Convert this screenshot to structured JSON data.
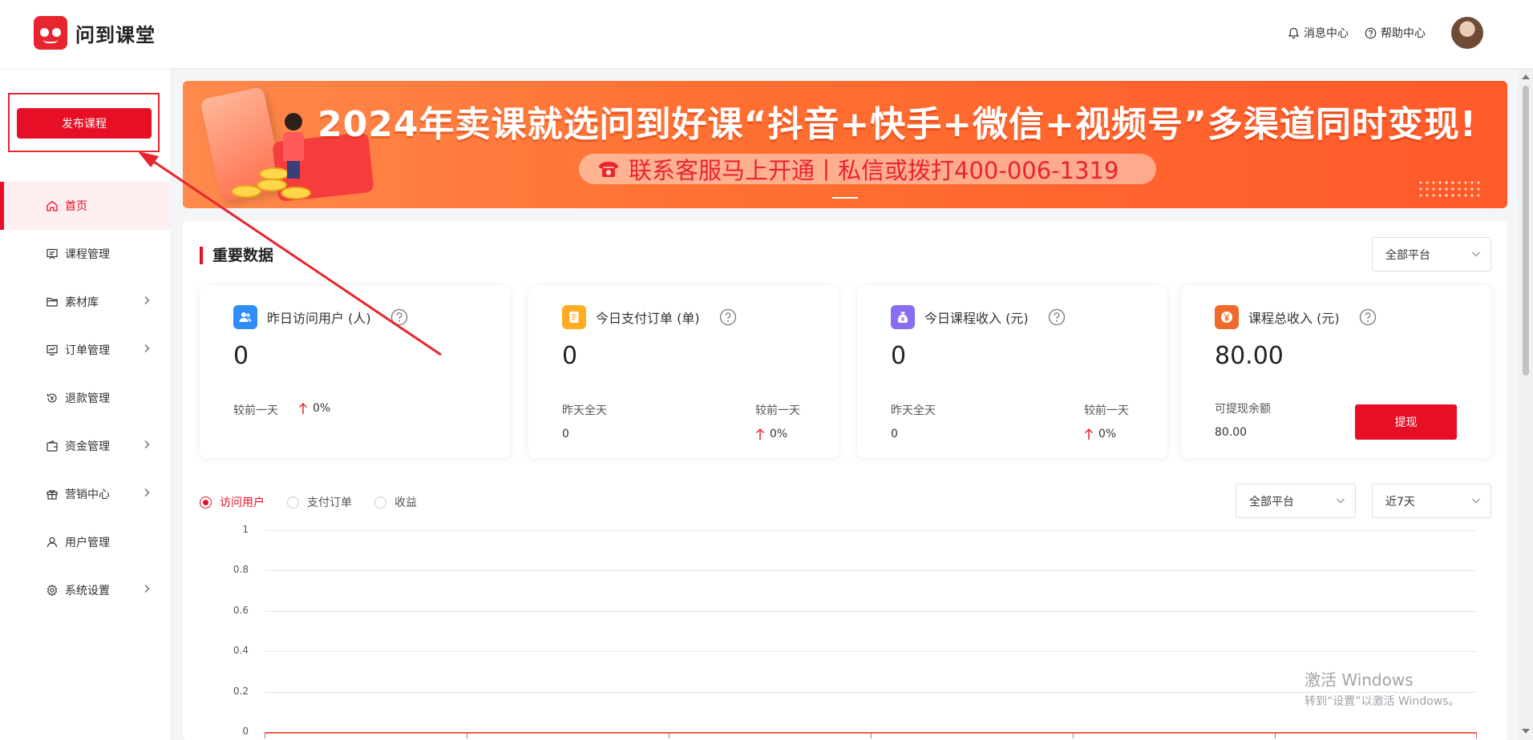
{
  "app": {
    "name": "问到课堂"
  },
  "header": {
    "messages": "消息中心",
    "help": "帮助中心"
  },
  "sidebar": {
    "publish": "发布课程",
    "items": [
      {
        "label": "首页",
        "icon": "home-icon",
        "active": true
      },
      {
        "label": "课程管理",
        "icon": "course-icon"
      },
      {
        "label": "素材库",
        "icon": "folder-icon",
        "expandable": true
      },
      {
        "label": "订单管理",
        "icon": "order-icon",
        "expandable": true
      },
      {
        "label": "退款管理",
        "icon": "refund-icon"
      },
      {
        "label": "资金管理",
        "icon": "wallet-icon",
        "expandable": true
      },
      {
        "label": "营销中心",
        "icon": "gift-icon",
        "expandable": true
      },
      {
        "label": "用户管理",
        "icon": "user-icon"
      },
      {
        "label": "系统设置",
        "icon": "gear-icon",
        "expandable": true
      }
    ]
  },
  "banner": {
    "title": "2024年卖课就选问到好课“抖音+快手+微信+视频号”多渠道同时变现!",
    "subtitle": "联系客服马上开通丨私信或拨打400-006-1319"
  },
  "stats": {
    "title": "重要数据",
    "platform_select": "全部平台",
    "cards": [
      {
        "label": "昨日访问用户 (人)",
        "value": "0",
        "compare_label": "较前一天",
        "change": "0%",
        "icon": "users-icon",
        "color": "#2f8ef7"
      },
      {
        "label": "今日支付订单 (单)",
        "value": "0",
        "yesterday_label": "昨天全天",
        "yesterday_value": "0",
        "compare_label": "较前一天",
        "change": "0%",
        "icon": "note-icon",
        "color": "#ffad23"
      },
      {
        "label": "今日课程收入 (元)",
        "value": "0",
        "yesterday_label": "昨天全天",
        "yesterday_value": "0",
        "compare_label": "较前一天",
        "change": "0%",
        "icon": "money-bag-icon",
        "color": "#8a6cf2"
      },
      {
        "label": "课程总收入 (元)",
        "value": "80.00",
        "balance_label": "可提现余额",
        "balance_value": "80.00",
        "withdraw": "提现",
        "icon": "yen-icon",
        "color": "#f06a2b"
      }
    ]
  },
  "trend": {
    "tabs": [
      {
        "label": "访问用户",
        "selected": true
      },
      {
        "label": "支付订单"
      },
      {
        "label": "收益"
      }
    ],
    "platform_select": "全部平台",
    "range_select": "近7天"
  },
  "chart_data": {
    "type": "line",
    "y_ticks": [
      "1",
      "0.8",
      "0.6",
      "0.4",
      "0.2",
      "0"
    ],
    "ylim": [
      0,
      1
    ],
    "grid": true,
    "series": [
      {
        "values": [
          0,
          0,
          0,
          0,
          0,
          0,
          0
        ]
      }
    ]
  },
  "watermark": {
    "line1": "激活 Windows",
    "line2": "转到“设置”以激活 Windows。"
  },
  "colors": {
    "accent": "#e60f25"
  }
}
